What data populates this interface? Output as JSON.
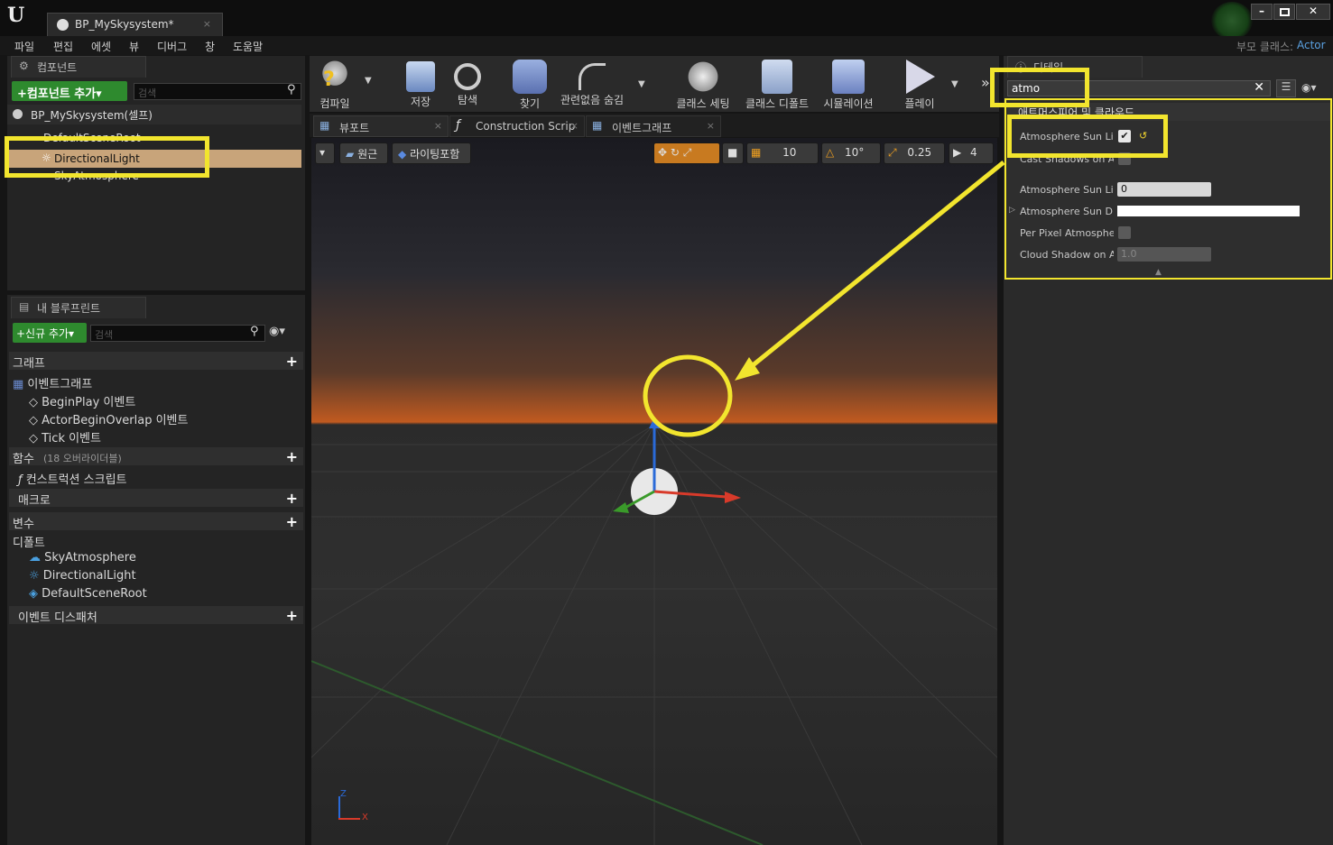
{
  "app": {
    "logo": "U",
    "tab_title": "BP_MySkysystem*",
    "parent_class_label": "부모 클래스:",
    "parent_class_value": "Actor"
  },
  "menu": [
    "파일",
    "편집",
    "에셋",
    "뷰",
    "디버그",
    "창",
    "도움말"
  ],
  "components": {
    "panel_title": "컴포넌트",
    "add_button": "+컴포넌트 추가▾",
    "search_placeholder": "검색",
    "self_label": "BP_MySkysystem(셀프)",
    "tree": [
      "DefaultSceneRoot",
      "DirectionalLight",
      "SkyAtmosphere"
    ]
  },
  "blueprint": {
    "panel_title": "내 블루프린트",
    "add_new": "+신규 추가▾",
    "search_placeholder": "검색",
    "sections": {
      "graphs": "그래프",
      "event_graph": "이벤트그래프",
      "events": [
        "BeginPlay 이벤트",
        "ActorBeginOverlap 이벤트",
        "Tick 이벤트"
      ],
      "functions": "함수",
      "functions_sub": "(18 오버라이더블)",
      "construction_script": "컨스트럭션 스크립트",
      "macros": "매크로",
      "variables": "변수",
      "defaults": "디폴트",
      "default_items": [
        "SkyAtmosphere",
        "DirectionalLight",
        "DefaultSceneRoot"
      ],
      "dispatchers": "이벤트 디스패처"
    }
  },
  "toolbar": [
    "컴파일",
    "저장",
    "탐색",
    "찾기",
    "관련없음 숨김",
    "클래스 세팅",
    "클래스 디폴트",
    "시뮬레이션",
    "플레이"
  ],
  "editor_tabs": [
    "뷰포트",
    "Construction Scrip",
    "이벤트그래프"
  ],
  "viewport": {
    "perspective": "원근",
    "lighting": "라이팅포함",
    "grid_snap": "10",
    "rotate_snap": "10°",
    "scale_snap": "0.25",
    "camera_speed": "4",
    "axis_x": "X",
    "axis_z": "Z"
  },
  "details": {
    "panel_title": "디테일",
    "search_value": "atmo",
    "category": "애트머스피어 및 클라우드",
    "props": [
      {
        "label": "Atmosphere Sun Ligh",
        "type": "checkbox",
        "checked": true
      },
      {
        "label": "Cast Shadows on Atn",
        "type": "checkbox",
        "checked": false
      },
      {
        "label": "Atmosphere Sun Ligh",
        "type": "number",
        "value": "0"
      },
      {
        "label": "Atmosphere Sun Dis",
        "type": "color"
      },
      {
        "label": "Per Pixel Atmospher",
        "type": "checkbox",
        "checked": false
      },
      {
        "label": "Cloud Shadow on Atn",
        "type": "number",
        "value": "1.0"
      }
    ]
  },
  "colors": {
    "highlight": "#f2e52e",
    "accent": "#2e8a2e",
    "selected_row": "#c8a47a"
  }
}
